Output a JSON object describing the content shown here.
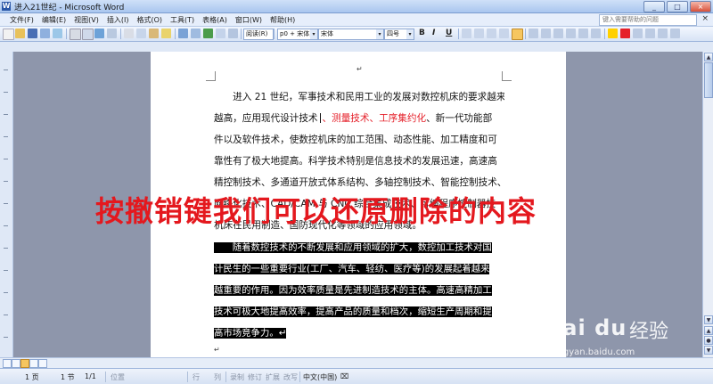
{
  "window": {
    "title": "进入21世纪 - Microsoft Word",
    "app_icon_letter": "W",
    "controls": [
      "_",
      "□",
      "×"
    ]
  },
  "menubar": {
    "items": [
      "文件(F)",
      "编辑(E)",
      "视图(V)",
      "插入(I)",
      "格式(O)",
      "工具(T)",
      "表格(A)",
      "窗口(W)",
      "帮助(H)"
    ],
    "help_placeholder": "键入需要帮助的问题",
    "close_glyph": "×"
  },
  "toolbar": {
    "style_value": "p0 + 宋体,",
    "font_value": "宋体",
    "size_value": "四号",
    "reading_label": "阅读(R)",
    "bold": "B",
    "italic": "I",
    "underline": "U",
    "dropdown_glyph": "▾",
    "colors": {
      "highlight": "#ffd000",
      "font_color": "#e5202a",
      "active_button": "#f6c660"
    }
  },
  "document": {
    "para1_lines": [
      "　　进入 21 世纪，军事技术和民用工业的发展对数控机床的要求越来",
      "越高，应用现代设计技术",
      "件以及软件技术，使数控机床的加工范围、动态性能、加工精度和可",
      "靠性有了极大地提高。科学技术特别是信息技术的发展迅速，高速高",
      "精控制技术、多通道开放式体系结构、多轴控制技术、智能控制技术、",
      "网络化技术、CAD/CAM 与 CNC 综合集成技术、可编程序控制器技",
      "机床在民用制造、国防现代化等领域的应用领域。"
    ],
    "line2_red": "、测量技术、工序集约化",
    "line2_tail": "、新一代功能部",
    "para2_lines": [
      "　　随着数控技术的不断发展和应用领域的扩大，数控加工技术对国",
      "计民生的一些重要行业(工厂、汽车、轻纺、医疗等)的发展起着越来",
      "越重要的作用。因为效率质量是先进制造技术的主体。高速高精加工",
      "技术可极大地提高效率，提高产品的质量和档次，缩短生产周期和提",
      "高市场竞争力。↵"
    ],
    "paragraph_mark": "↵"
  },
  "overlay_caption": "按撤销键我们可以还原删除的内容",
  "statusbar": {
    "page": "1 页",
    "section": "1 节",
    "page_of": "1/1",
    "position": "位置",
    "line": "行",
    "column": "列",
    "record": "录制",
    "revision": "修订",
    "extend": "扩展",
    "overtype": "改写",
    "language": "中文(中国)"
  },
  "watermark": {
    "brand": "Bai du",
    "product": "经验",
    "url": "jingyan.baidu.com"
  }
}
